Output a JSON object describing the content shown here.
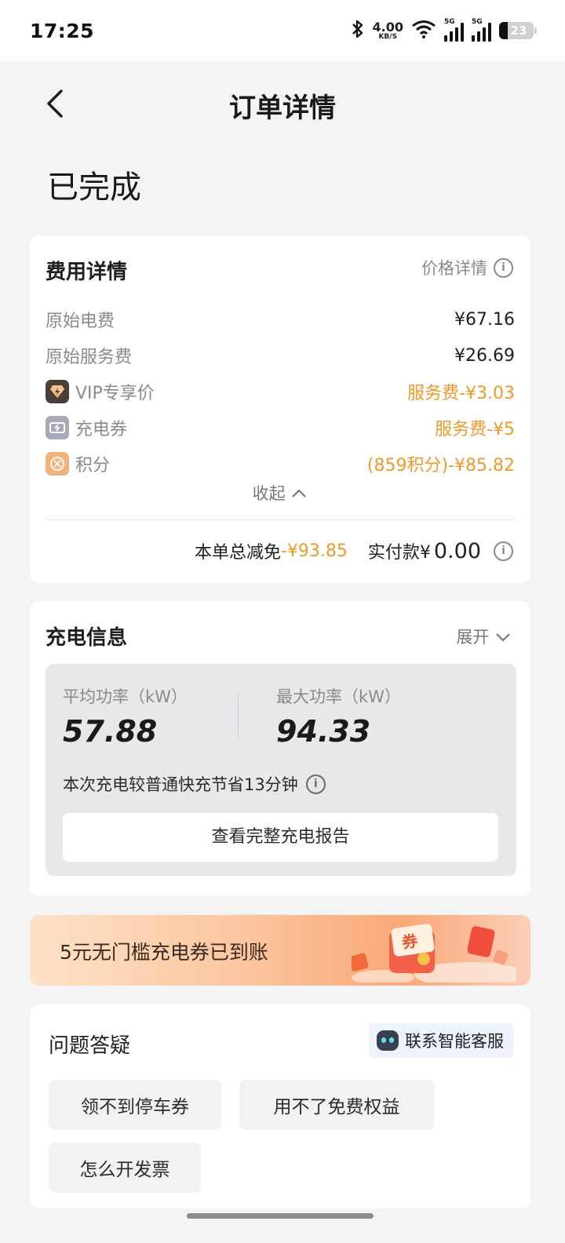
{
  "status_bar": {
    "time": "17:25",
    "net_speed_value": "4.00",
    "net_speed_unit": "KB/S",
    "signal_tag_1": "5G",
    "signal_tag_2": "5G",
    "battery": "23"
  },
  "header": {
    "title": "订单详情",
    "back_icon": "chevron-left-icon"
  },
  "order_status": "已完成",
  "fee_details": {
    "title": "费用详情",
    "price_detail_link": "价格详情",
    "rows": [
      {
        "label": "原始电费",
        "value": "¥67.16"
      },
      {
        "label": "原始服务费",
        "value": "¥26.69"
      },
      {
        "label": "VIP专享价",
        "value": "服务费-¥3.03",
        "icon": "vip-icon"
      },
      {
        "label": "充电券",
        "value": "服务费-¥5",
        "icon": "coupon-icon"
      },
      {
        "label": "积分",
        "value": "(859积分)-¥85.82",
        "icon": "points-icon"
      }
    ],
    "collapse_label": "收起",
    "total_discount_label": "本单总减免",
    "total_discount_value": "-¥93.85",
    "paid_label": "实付款¥",
    "paid_value": "0.00",
    "colors": {
      "accent": "#ef9a2a"
    }
  },
  "charging_info": {
    "title": "充电信息",
    "expand_label": "展开",
    "avg_power_label": "平均功率（kW）",
    "avg_power_value": "57.88",
    "max_power_label": "最大功率（kW）",
    "max_power_value": "94.33",
    "saving_text": "本次充电较普通快充节省13分钟",
    "report_button": "查看完整充电报告"
  },
  "banner": {
    "text": "5元无门槛充电券已到账",
    "coupon_glyph": "券"
  },
  "faq": {
    "title": "问题答疑",
    "service_button": "联系智能客服",
    "chips": [
      "领不到停车券",
      "用不了免费权益",
      "怎么开发票"
    ]
  }
}
